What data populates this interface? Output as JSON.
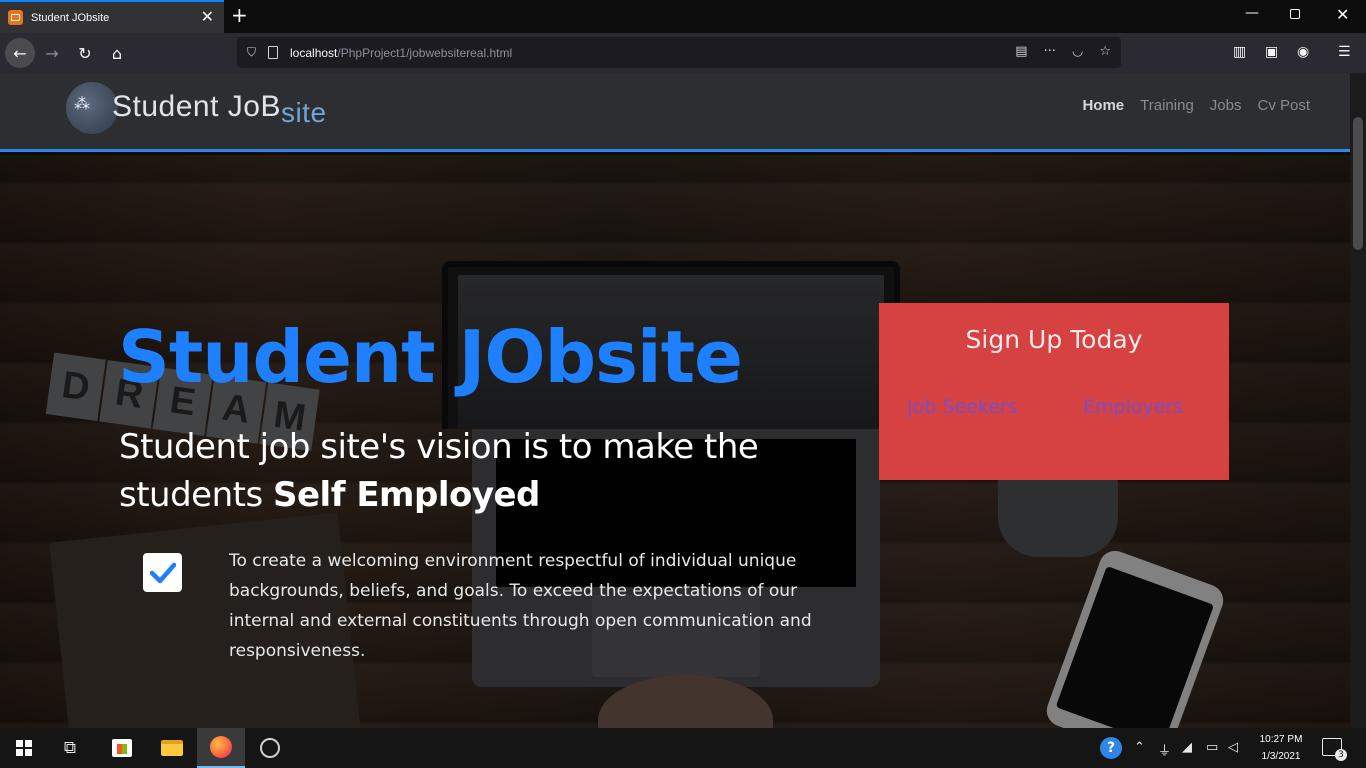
{
  "browser": {
    "tab": {
      "title": "Student JObsite",
      "close_icon": "close-icon"
    },
    "new_tab_label": "+",
    "window_controls": {
      "minimize": "—",
      "close": "✕"
    },
    "url": {
      "host": "localhost",
      "path": "/PhpProject1/jobwebsitereal.html"
    }
  },
  "site": {
    "logo": {
      "text_main": "Student JoB",
      "text_accent": "site"
    },
    "nav": [
      {
        "label": "Home",
        "active": true
      },
      {
        "label": "Training",
        "active": false
      },
      {
        "label": "Jobs",
        "active": false
      },
      {
        "label": "Cv Post",
        "active": false
      }
    ]
  },
  "hero": {
    "title": "Student JObsite",
    "subtitle_start": "Student job site's vision is to make the students ",
    "subtitle_bold": "Self Employed",
    "paragraph": "To create a welcoming environment respectful of individual unique backgrounds, beliefs, and goals. To exceed the expectations of our internal and external constituents through open communication and responsiveness.",
    "background_word": "DREAM"
  },
  "signup": {
    "title": "Sign Up Today",
    "job_seekers": "Job Seekers",
    "employers": "Employers"
  },
  "taskbar": {
    "clock_time": "10:27 PM",
    "clock_date": "1/3/2021",
    "notification_count": "3"
  },
  "colors": {
    "brand_blue": "#1e7fff",
    "header_accent": "#2f86e8",
    "signup_red": "#d64141",
    "signup_link": "#7a4ec6"
  }
}
